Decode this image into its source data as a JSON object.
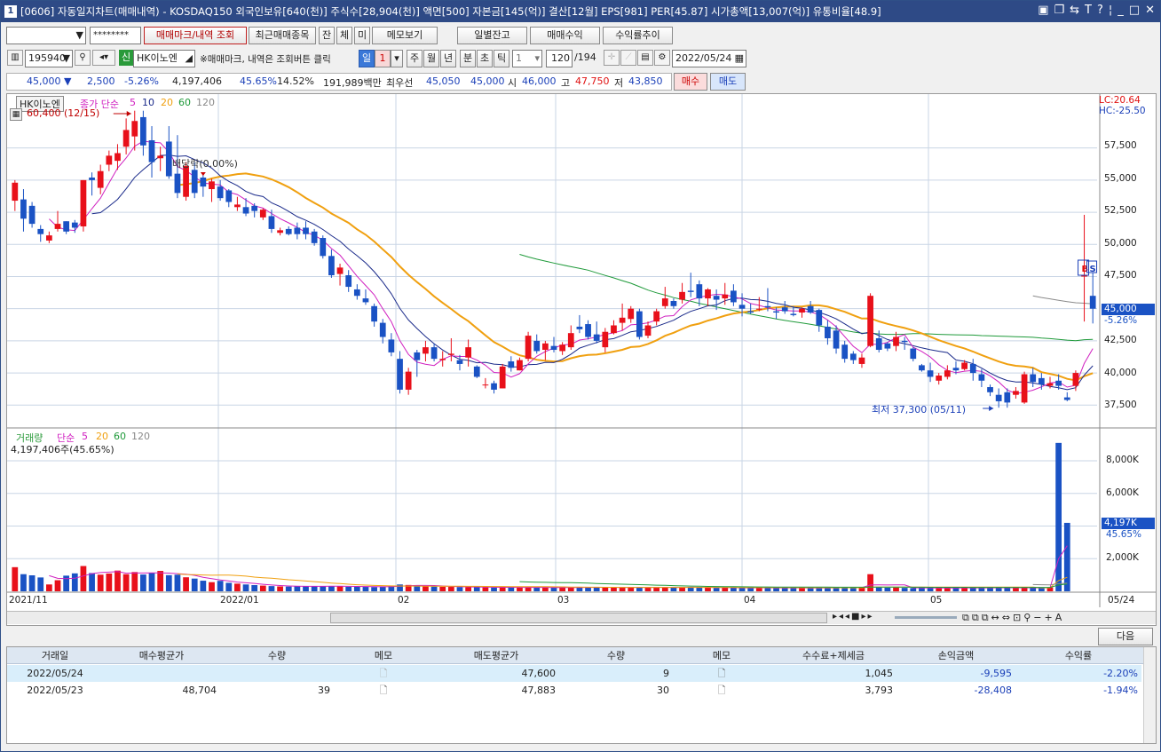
{
  "title": {
    "num": "1",
    "text": "[0606] 자동일지차트(매매내역) - KOSDAQ150 외국인보유[640(천)] 주식수[28,904(천)] 액면[500] 자본금[145(억)] 결산[12월] EPS[981] PER[45.87] 시가총액[13,007(억)] 유통비율[48.9]"
  },
  "toolbar1": {
    "account_mask": "********",
    "btn_marks": "매매마크/내역 조회",
    "btn_recent": "최근매매종목",
    "btn_jan": "잔",
    "btn_che": "체",
    "btn_mi": "미",
    "btn_memo": "메모보기",
    "btn_daily": "일별잔고",
    "btn_profit": "매매수익",
    "btn_trend": "수익률추이"
  },
  "toolbar2": {
    "code": "195940",
    "badge": "신",
    "stock_name": "HK이노엔",
    "hint": "※매매마크, 내역은 조회버튼 클릭",
    "periods": [
      "일",
      "1",
      "주",
      "월",
      "년",
      "분",
      "초",
      "틱"
    ],
    "tick_value": "1",
    "count": "120",
    "count_total": "/194",
    "date": "2022/05/24"
  },
  "quote": {
    "price": "45,000",
    "arrow": "▼",
    "change": "2,500",
    "change_pct": "-5.26%",
    "volume": "4,197,406",
    "vol_ratio": "45.65%",
    "turnover": "14.52%",
    "amount": "191,989백만",
    "best_label": "최우선",
    "best_ask": "45,050",
    "best_bid": "45,000",
    "open_label": "시",
    "open": "46,000",
    "high_label": "고",
    "high": "47,750",
    "low_label": "저",
    "low": "43,850",
    "buy": "매수",
    "sell": "매도"
  },
  "chart_labels": {
    "name_tab": "HK이노엔",
    "ma_title": "종가 단순",
    "ma5": "5",
    "ma10": "10",
    "ma20": "20",
    "ma60": "60",
    "ma120": "120",
    "high_note": "60,400 (12/15)",
    "div_note": "배당락(0.00%)",
    "low_note": "최저 37,300 (05/11)",
    "lc": "LC:20.64",
    "hc": "HC:-25.50",
    "price_axis": [
      "57,500",
      "55,000",
      "52,500",
      "50,000",
      "47,500",
      "45,000",
      "42,500",
      "40,000",
      "37,500"
    ],
    "cur_price": "45,000",
    "cur_pct": "-5.26%",
    "vol_title": "거래량",
    "vol_ma_title": "단순",
    "vol_ma5": "5",
    "vol_ma20": "20",
    "vol_ma60": "60",
    "vol_ma120": "120",
    "vol_text": "4,197,406주(45.65%)",
    "vol_axis": [
      "8,000K",
      "6,000K",
      "4,000K",
      "2,000K"
    ],
    "cur_vol": "4,197K",
    "cur_vol_pct": "45.65%",
    "date_axis": [
      "2021/11",
      "2022/01",
      "02",
      "03",
      "04",
      "05",
      "05/24"
    ],
    "mark_b": "B",
    "mark_s": "S"
  },
  "colors": {
    "up": "#e8101a",
    "down": "#1a52c4",
    "ma5": "#d020c0",
    "ma10": "#1a2a8a",
    "ma20": "#f0a010",
    "ma60": "#1f9a3a",
    "ma120": "#8a8a8a",
    "grid": "#c9d5e5"
  },
  "chart_data": {
    "type": "candlestick",
    "ohlc": [
      [
        53400,
        55000,
        52600,
        54800
      ],
      [
        53500,
        54300,
        51000,
        52000
      ],
      [
        53000,
        53300,
        51300,
        51600
      ],
      [
        51200,
        51500,
        50200,
        50800
      ],
      [
        50300,
        51000,
        50100,
        50700
      ],
      [
        51200,
        52600,
        51000,
        51600
      ],
      [
        51800,
        51800,
        50800,
        51000
      ],
      [
        51700,
        51900,
        50900,
        51300
      ],
      [
        51400,
        55000,
        51000,
        55000
      ],
      [
        55200,
        55600,
        53800,
        55000
      ],
      [
        54400,
        56200,
        53900,
        55700
      ],
      [
        56200,
        57300,
        55700,
        56900
      ],
      [
        56500,
        57800,
        55800,
        57100
      ],
      [
        57600,
        59800,
        57000,
        58900
      ],
      [
        58400,
        60400,
        57300,
        59600
      ],
      [
        59900,
        60400,
        56900,
        57700
      ],
      [
        58100,
        59200,
        55200,
        56400
      ],
      [
        56700,
        57600,
        55700,
        56900
      ],
      [
        58000,
        59200,
        55100,
        55300
      ],
      [
        55500,
        58500,
        53600,
        54000
      ],
      [
        53700,
        56400,
        53400,
        56100
      ],
      [
        55800,
        56400,
        53600,
        54000
      ],
      [
        55200,
        55600,
        53700,
        54500
      ],
      [
        54300,
        55100,
        53300,
        54900
      ],
      [
        54500,
        55000,
        53400,
        53600
      ],
      [
        54200,
        54300,
        52900,
        53300
      ],
      [
        52900,
        53700,
        52600,
        53100
      ],
      [
        52900,
        53600,
        52200,
        52400
      ],
      [
        53000,
        53200,
        52100,
        52600
      ],
      [
        52100,
        52800,
        51900,
        52700
      ],
      [
        52200,
        52700,
        50900,
        51200
      ],
      [
        50900,
        51300,
        50700,
        51100
      ],
      [
        51200,
        51400,
        50700,
        50800
      ],
      [
        51300,
        51700,
        50400,
        50800
      ],
      [
        51300,
        51800,
        50400,
        50800
      ],
      [
        51000,
        51200,
        49900,
        50100
      ],
      [
        50500,
        50700,
        48900,
        49100
      ],
      [
        49100,
        49600,
        47400,
        47600
      ],
      [
        47700,
        48500,
        46800,
        48200
      ],
      [
        47600,
        48000,
        46300,
        46700
      ],
      [
        46500,
        46900,
        45700,
        46000
      ],
      [
        45800,
        46500,
        45300,
        45500
      ],
      [
        45200,
        45400,
        43600,
        44000
      ],
      [
        43900,
        44200,
        42300,
        42800
      ],
      [
        42600,
        43100,
        41300,
        41600
      ],
      [
        41100,
        41700,
        38400,
        38700
      ],
      [
        38700,
        40400,
        38300,
        40100
      ],
      [
        41600,
        41800,
        39700,
        41000
      ],
      [
        41500,
        42500,
        40900,
        42000
      ],
      [
        42000,
        42300,
        40900,
        41100
      ],
      [
        41000,
        41700,
        40500,
        41100
      ],
      [
        41400,
        42700,
        40900,
        41500
      ],
      [
        41000,
        41400,
        40200,
        40700
      ],
      [
        41200,
        42600,
        40500,
        42000
      ],
      [
        40500,
        40600,
        39600,
        39700
      ],
      [
        39100,
        39600,
        38800,
        39100
      ],
      [
        39200,
        39400,
        38400,
        38700
      ],
      [
        38800,
        40700,
        38800,
        40500
      ],
      [
        40900,
        41300,
        40100,
        40400
      ],
      [
        40200,
        41200,
        40200,
        41000
      ],
      [
        41100,
        43200,
        40900,
        42900
      ],
      [
        42500,
        43000,
        41500,
        41700
      ],
      [
        41800,
        42500,
        41000,
        42300
      ],
      [
        42100,
        42800,
        41600,
        41800
      ],
      [
        41700,
        42400,
        41400,
        42200
      ],
      [
        42000,
        43700,
        41800,
        43100
      ],
      [
        43600,
        44500,
        43100,
        43400
      ],
      [
        43800,
        44100,
        42600,
        42800
      ],
      [
        43000,
        44000,
        42300,
        42500
      ],
      [
        42000,
        43500,
        41600,
        43200
      ],
      [
        43100,
        44100,
        43000,
        43700
      ],
      [
        43900,
        45400,
        43300,
        44300
      ],
      [
        44200,
        45200,
        43900,
        45000
      ],
      [
        44800,
        45000,
        42600,
        42800
      ],
      [
        42900,
        44000,
        42700,
        43700
      ],
      [
        44000,
        45000,
        43700,
        44800
      ],
      [
        45200,
        46700,
        45000,
        45800
      ],
      [
        45600,
        45800,
        45000,
        45200
      ],
      [
        45700,
        47000,
        45400,
        46300
      ],
      [
        46400,
        47800,
        45900,
        46300
      ],
      [
        46900,
        47200,
        45200,
        45800
      ],
      [
        45800,
        46600,
        45200,
        46500
      ],
      [
        46000,
        46500,
        44900,
        45700
      ],
      [
        45800,
        47000,
        45300,
        46100
      ],
      [
        46400,
        46900,
        45200,
        45500
      ],
      [
        45300,
        46200,
        44400,
        45000
      ],
      [
        44800,
        45400,
        44600,
        44700
      ],
      [
        45000,
        45900,
        44800,
        45000
      ],
      [
        45200,
        46600,
        44800,
        45100
      ],
      [
        44800,
        45100,
        44200,
        44700
      ],
      [
        45100,
        45600,
        44600,
        44800
      ],
      [
        44600,
        45200,
        44400,
        44500
      ],
      [
        44700,
        45100,
        44300,
        45000
      ],
      [
        45200,
        45600,
        44600,
        44700
      ],
      [
        44900,
        45000,
        43200,
        43700
      ],
      [
        43600,
        44100,
        42200,
        42700
      ],
      [
        43300,
        43700,
        41500,
        41900
      ],
      [
        42200,
        42500,
        40800,
        41100
      ],
      [
        41500,
        41700,
        40700,
        41000
      ],
      [
        40700,
        41500,
        40400,
        41200
      ],
      [
        42100,
        46200,
        42000,
        46000
      ],
      [
        42700,
        43300,
        41600,
        41800
      ],
      [
        42300,
        42400,
        41700,
        41900
      ],
      [
        42100,
        43200,
        41700,
        42800
      ],
      [
        42500,
        42800,
        41800,
        42400
      ],
      [
        41900,
        42000,
        40900,
        41100
      ],
      [
        40600,
        40700,
        40100,
        40200
      ],
      [
        40200,
        40800,
        39300,
        39700
      ],
      [
        39400,
        40000,
        39100,
        39800
      ],
      [
        39700,
        40600,
        39500,
        40200
      ],
      [
        40400,
        40900,
        39900,
        40200
      ],
      [
        40300,
        41000,
        40200,
        40800
      ],
      [
        40700,
        41100,
        39400,
        40000
      ],
      [
        39900,
        40300,
        38900,
        39400
      ],
      [
        38900,
        39100,
        38200,
        38500
      ],
      [
        38300,
        38800,
        37300,
        37800
      ],
      [
        38500,
        38800,
        37300,
        37700
      ],
      [
        38300,
        38900,
        38000,
        38600
      ],
      [
        37700,
        40100,
        37600,
        39900
      ],
      [
        39900,
        40400,
        38900,
        39300
      ],
      [
        39600,
        40000,
        38700,
        39100
      ],
      [
        39000,
        39700,
        38800,
        39200
      ],
      [
        39400,
        39900,
        38700,
        39000
      ],
      [
        38100,
        38500,
        37800,
        37900
      ],
      [
        39000,
        40200,
        38600,
        40000
      ],
      [
        47500,
        52300,
        44000,
        47600
      ],
      [
        46000,
        47800,
        43850,
        45000
      ]
    ],
    "volume": [
      1480,
      1050,
      980,
      850,
      420,
      680,
      960,
      1100,
      1550,
      1120,
      1020,
      1090,
      1270,
      1050,
      1180,
      1030,
      1140,
      1250,
      990,
      1020,
      860,
      780,
      650,
      560,
      640,
      520,
      470,
      420,
      380,
      350,
      320,
      300,
      290,
      300,
      320,
      310,
      300,
      320,
      310,
      280,
      290,
      270,
      260,
      300,
      320,
      420,
      390,
      360,
      310,
      290,
      280,
      270,
      260,
      250,
      280,
      240,
      230,
      230,
      250,
      240,
      260,
      230,
      220,
      230,
      220,
      240,
      260,
      250,
      240,
      230,
      220,
      250,
      270,
      230,
      220,
      240,
      260,
      250,
      240,
      250,
      220,
      230,
      210,
      220,
      230,
      210,
      200,
      220,
      230,
      210,
      200,
      210,
      200,
      220,
      200,
      230,
      220,
      240,
      210,
      220,
      1050,
      240,
      220,
      230,
      210,
      200,
      210,
      200,
      220,
      210,
      200,
      230,
      210,
      200,
      220,
      240,
      210,
      230,
      200,
      220,
      210,
      240,
      9100,
      4197
    ]
  },
  "table": {
    "next_btn": "다음",
    "headers": [
      "거래일",
      "매수평균가",
      "수량",
      "메모",
      "매도평균가",
      "수량",
      "메모",
      "수수료+제세금",
      "손익금액",
      "수익률"
    ],
    "rows": [
      [
        "2022/05/24",
        "",
        "",
        "",
        "47,600",
        "9",
        "",
        "1,045",
        "-9,595",
        "-2.20%"
      ],
      [
        "2022/05/23",
        "48,704",
        "39",
        "",
        "47,883",
        "30",
        "",
        "3,793",
        "-28,408",
        "-1.94%"
      ]
    ]
  }
}
